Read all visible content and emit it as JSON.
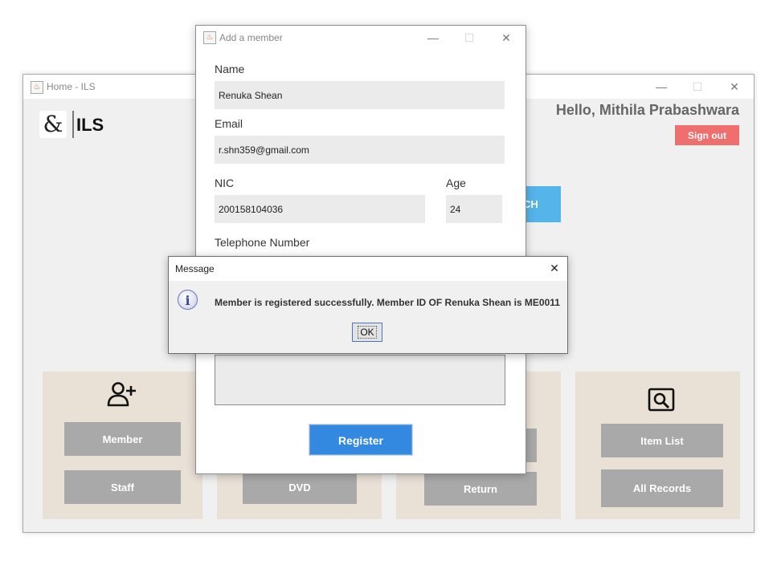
{
  "home": {
    "title": "Home - ILS",
    "logo_glyph": "&",
    "logo_text": "ILS",
    "greeting": "Hello, Mithila Prabashwara",
    "signout_label": "Sign out",
    "search_partial_label": "CH",
    "panels": [
      {
        "icon": "add-user-icon",
        "buttons": [
          "Member",
          "Staff"
        ]
      },
      {
        "icon": "",
        "buttons": [
          "DVD"
        ]
      },
      {
        "icon": "",
        "buttons": [
          "Return"
        ]
      },
      {
        "icon": "search-icon",
        "buttons": [
          "Item List",
          "All Records"
        ]
      }
    ]
  },
  "add_member": {
    "title": "Add a member",
    "name_label": "Name",
    "name_value": "Renuka Shean",
    "email_label": "Email",
    "email_value": "r.shn359@gmail.com",
    "nic_label": "NIC",
    "nic_value": "200158104036",
    "age_label": "Age",
    "age_value": "24",
    "telephone_label": "Telephone Number",
    "register_label": "Register"
  },
  "message": {
    "title": "Message",
    "text": "Member is registered successfully. Member ID OF Renuka Shean is ME0011",
    "ok_label": "OK",
    "icon": "info-icon"
  },
  "window_controls": {
    "minimize": "—",
    "maximize": "☐",
    "close": "✕"
  }
}
